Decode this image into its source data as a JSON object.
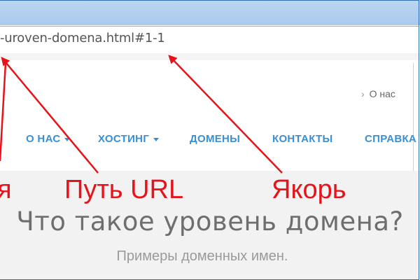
{
  "browser": {
    "address_text": "-uroven-domena.html#1-1"
  },
  "breadcrumb": {
    "separator": "›",
    "label": "О нас"
  },
  "nav": {
    "items": [
      {
        "label": "О НАС",
        "has_dropdown": true
      },
      {
        "label": "ХОСТИНГ",
        "has_dropdown": true
      },
      {
        "label": "ДОМЕНЫ",
        "has_dropdown": false
      },
      {
        "label": "КОНТАКТЫ",
        "has_dropdown": false
      },
      {
        "label": "СПРАВКА",
        "has_dropdown": false
      }
    ]
  },
  "hero": {
    "title": "Что такое уровень домена?",
    "subtitle": "Примеры доменных имен."
  },
  "annotations": {
    "left_fragment": "я",
    "path_label": "Путь URL",
    "anchor_label": "Якорь"
  },
  "colors": {
    "annotation_red": "#e8121a",
    "nav_blue": "#3a8fd4",
    "window_blue": "#2f6fb3"
  }
}
